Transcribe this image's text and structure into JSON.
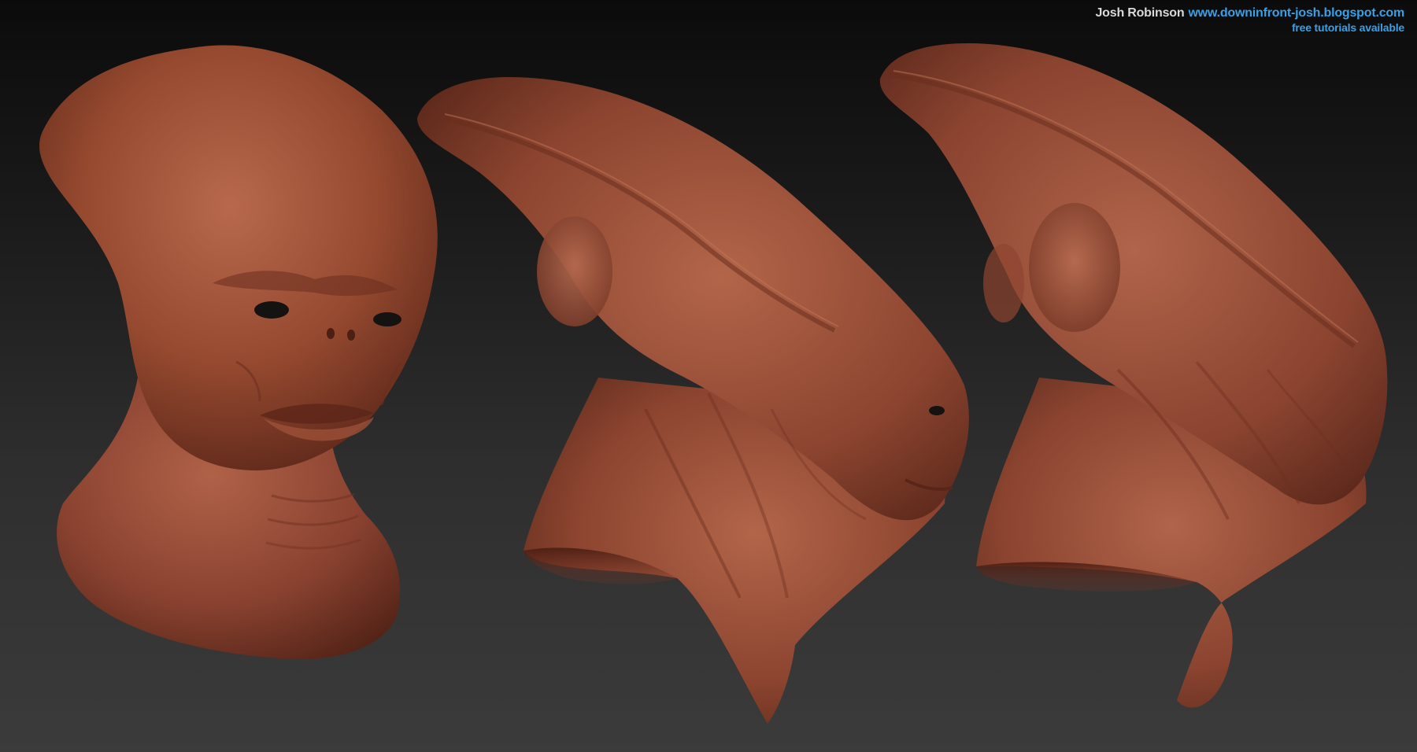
{
  "credit": {
    "author": "Josh Robinson",
    "url": "www.downinfront-josh.blogspot.com",
    "tagline": "free tutorials available"
  },
  "views": [
    {
      "name": "front-view",
      "description": "alien bust, front three-quarter view"
    },
    {
      "name": "side-view",
      "description": "alien bust, side view"
    },
    {
      "name": "back-view",
      "description": "alien bust, rear three-quarter view"
    }
  ],
  "colors": {
    "background_top": "#0b0b0b",
    "background_bottom": "#3b3b3b",
    "clay_light": "#b4644a",
    "clay_mid": "#8e4532",
    "clay_dark": "#5a2619",
    "eye": "#151212",
    "credit_name": "#d9d9d9",
    "credit_link": "#3aa0e6"
  }
}
